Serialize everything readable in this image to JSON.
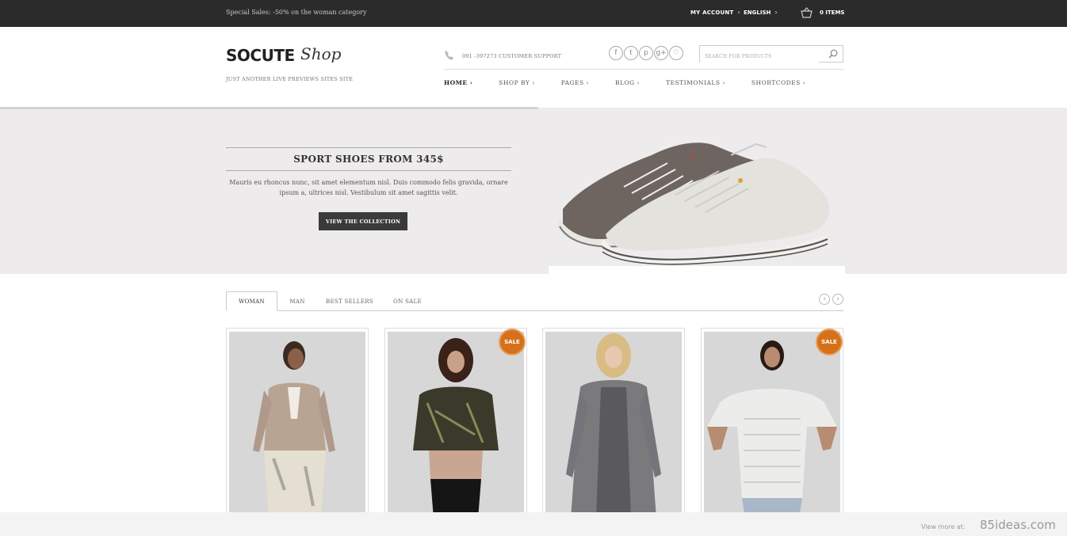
{
  "topbar": {
    "promo": "Special Sales: -50% on the woman category",
    "account": "MY ACCOUNT",
    "language": "ENGLISH",
    "chevron": "›",
    "cart_items": "0 ITEMS",
    "cart_icon": "basket-icon"
  },
  "header": {
    "logo_main": "SOCUTE",
    "logo_script": "Shop",
    "tagline": "JUST ANOTHER LIVE PREVIEWS SITES SITE",
    "support": "091 -397273 CUSTOMER SUPPORT",
    "socials": [
      "f",
      "t",
      "p",
      "g+",
      "♡"
    ],
    "search_placeholder": "SEARCH FOR PRODUCTS"
  },
  "nav": {
    "items": [
      "HOME ›",
      "SHOP BY ›",
      "PAGES ›",
      "BLOG ›",
      "TESTIMONIALS ›",
      "SHORTCODES ›"
    ]
  },
  "hero": {
    "title": "SPORT SHOES FROM 345$",
    "text": "Mauris eu rhoncus nunc, sit amet elementum nisl. Duis commodo felis gravida, ornare ipsum a, ultrices nisl. Vestibulum sit amet sagittis velit.",
    "button": "VIEW THE COLLECTION"
  },
  "tabs": {
    "items": [
      "WOMAN",
      "MAN",
      "BEST SELLERS",
      "ON SALE"
    ],
    "prev": "‹",
    "next": "›"
  },
  "products": {
    "sale_label": "SALE"
  },
  "footer": {
    "view_more": "View more at:",
    "brand": "85ideas.com"
  },
  "colors": {
    "topbar": "#2b2b2b",
    "hero_bg": "#edebeb",
    "sale_badge": "#d5711a",
    "button": "#3a3a3a"
  }
}
